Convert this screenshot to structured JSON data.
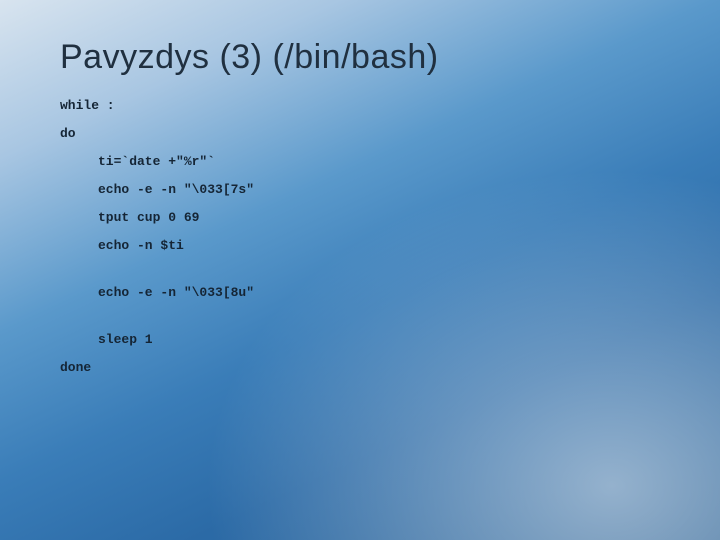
{
  "title": "Pavyzdys (3) (/bin/bash)",
  "code": {
    "l1": "while :",
    "l2": "do",
    "l3": "ti=`date +\"%r\"`",
    "l4": "echo -e -n \"\\033[7s\"",
    "l5": "tput cup 0 69",
    "l6": "echo -n $ti",
    "l7": "echo -e -n \"\\033[8u\"",
    "l8": "sleep 1",
    "l9": "done"
  }
}
